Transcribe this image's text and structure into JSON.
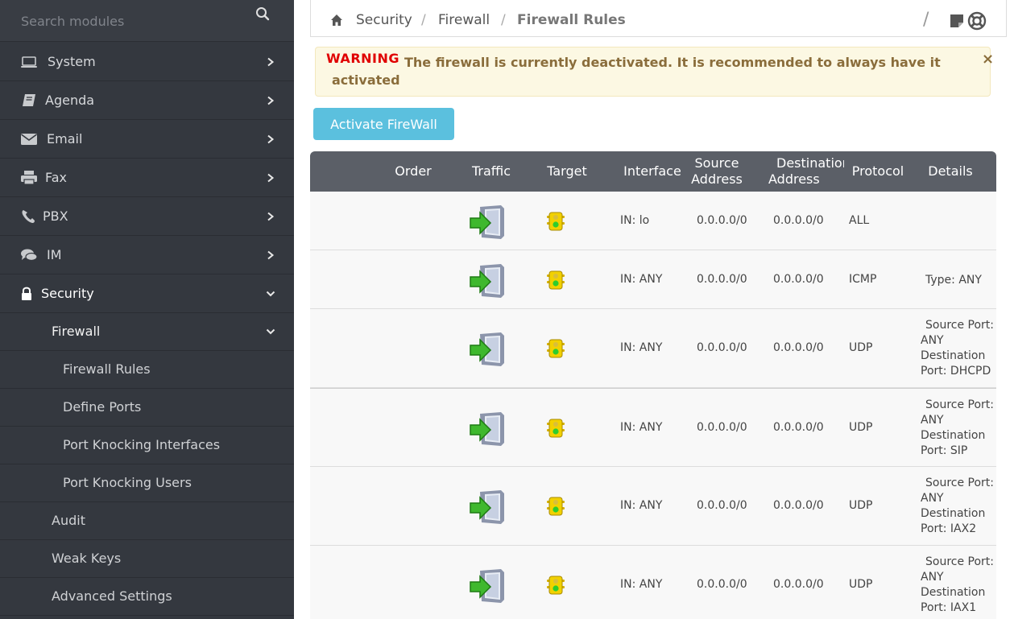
{
  "sidebar": {
    "search_placeholder": "Search modules",
    "items": [
      {
        "label": "System"
      },
      {
        "label": "Agenda"
      },
      {
        "label": "Email"
      },
      {
        "label": "Fax"
      },
      {
        "label": "PBX"
      },
      {
        "label": "IM"
      },
      {
        "label": "Security"
      },
      {
        "label": "Firewall"
      },
      {
        "label": "Firewall Rules"
      },
      {
        "label": "Define Ports"
      },
      {
        "label": "Port Knocking Interfaces"
      },
      {
        "label": "Port Knocking Users"
      },
      {
        "label": "Audit"
      },
      {
        "label": "Weak Keys"
      },
      {
        "label": "Advanced Settings"
      }
    ]
  },
  "breadcrumb": {
    "items": [
      "Security",
      "Firewall",
      "Firewall Rules"
    ],
    "separator": "/",
    "trailing_separator": "/"
  },
  "warning": {
    "title": "WARNING",
    "message": "The firewall is currently deactivated. It is recommended to always have it activated",
    "close": "×"
  },
  "actions": {
    "activate_label": "Activate FireWall"
  },
  "table": {
    "headers": {
      "order": "Order",
      "traffic": "Traffic",
      "target": "Target",
      "interface": "Interface",
      "source_1": "Source",
      "source_2": "Address",
      "dest_1": "Destination",
      "dest_2": "Address",
      "protocol": "Protocol",
      "details": "Details"
    },
    "rows": [
      {
        "interface": "IN: lo",
        "source": "0.0.0.0/0",
        "destination": "0.0.0.0/0",
        "protocol": "ALL",
        "details": ""
      },
      {
        "interface": "IN: ANY",
        "source": "0.0.0.0/0",
        "destination": "0.0.0.0/0",
        "protocol": "ICMP",
        "details": "Type: ANY"
      },
      {
        "interface": "IN: ANY",
        "source": "0.0.0.0/0",
        "destination": "0.0.0.0/0",
        "protocol": "UDP",
        "details": "Source Port: ANY Destination Port: DHCPD"
      },
      {
        "interface": "IN: ANY",
        "source": "0.0.0.0/0",
        "destination": "0.0.0.0/0",
        "protocol": "UDP",
        "details": "Source Port: ANY Destination Port: SIP"
      },
      {
        "interface": "IN: ANY",
        "source": "0.0.0.0/0",
        "destination": "0.0.0.0/0",
        "protocol": "UDP",
        "details": "Source Port: ANY Destination Port: IAX2"
      },
      {
        "interface": "IN: ANY",
        "source": "0.0.0.0/0",
        "destination": "0.0.0.0/0",
        "protocol": "UDP",
        "details": "Source Port: ANY Destination Port: IAX1"
      }
    ]
  },
  "icons": {
    "search": "search-icon",
    "home": "home-icon",
    "note": "sticky-note-icon",
    "help": "help-lifebuoy-icon",
    "traffic": "incoming-traffic-icon",
    "target": "traffic-light-accept-icon"
  },
  "colors": {
    "sidebar_bg": "#34383f",
    "table_header_bg": "#5b5f67",
    "activate_button": "#5bc0de",
    "warning_bg": "#fcf8e3",
    "warning_title": "#e00000",
    "warning_text": "#8a6d3b"
  }
}
